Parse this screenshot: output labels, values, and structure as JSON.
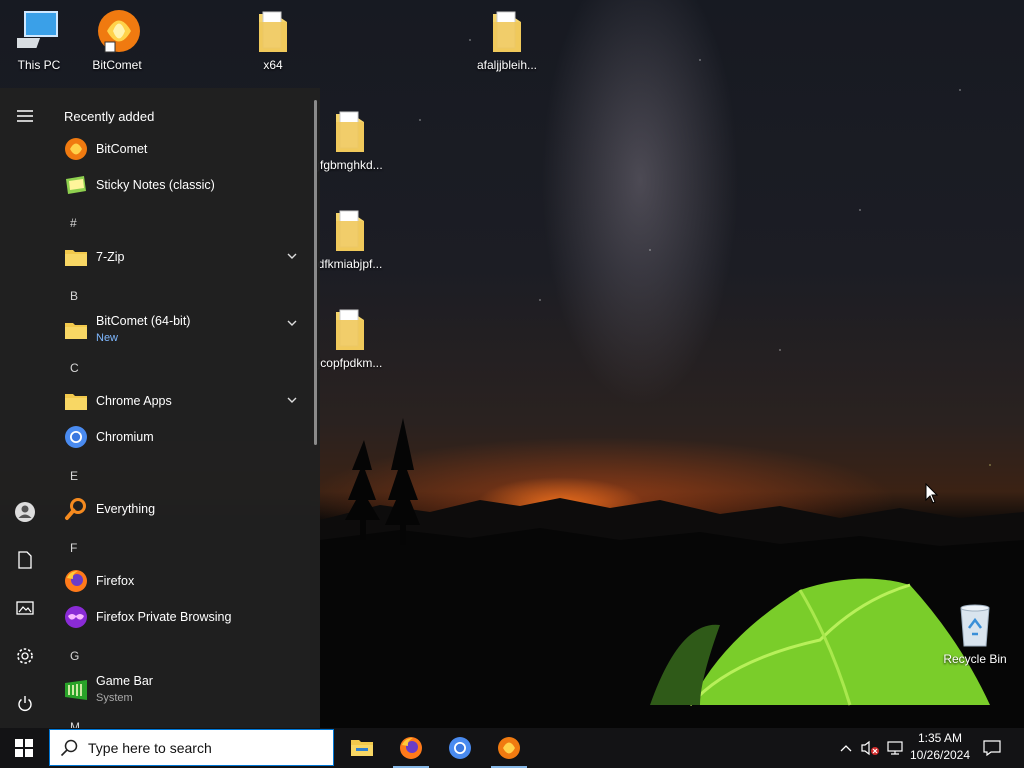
{
  "desktop": {
    "icons": [
      {
        "label": "This PC"
      },
      {
        "label": "BitComet"
      },
      {
        "label": "x64"
      },
      {
        "label": "afaljjbleih..."
      },
      {
        "label": "jfgbmghkd..."
      },
      {
        "label": "dfkmiabjpf..."
      },
      {
        "label": "jcopfpdkm..."
      },
      {
        "label": "Recycle Bin"
      }
    ]
  },
  "start_menu": {
    "section_title": "Recently added",
    "recent": [
      {
        "name": "BitComet",
        "icon": "bitcomet-icon"
      },
      {
        "name": "Sticky Notes (classic)",
        "icon": "sticky-notes-icon"
      }
    ],
    "letters": [
      "#",
      "B",
      "C",
      "E",
      "F",
      "G",
      "M"
    ],
    "apps": [
      {
        "name": "7-Zip",
        "icon": "folder-icon",
        "expandable": true
      },
      {
        "name": "BitComet (64-bit)",
        "sub": "New",
        "icon": "folder-icon",
        "expandable": true
      },
      {
        "name": "Chrome Apps",
        "icon": "folder-icon",
        "expandable": true
      },
      {
        "name": "Chromium",
        "icon": "chromium-icon"
      },
      {
        "name": "Everything",
        "icon": "everything-icon"
      },
      {
        "name": "Firefox",
        "icon": "firefox-icon"
      },
      {
        "name": "Firefox Private Browsing",
        "icon": "firefox-private-icon"
      },
      {
        "name": "Game Bar",
        "sub": "System",
        "icon": "game-bar-icon"
      }
    ],
    "rail": [
      "hamburger-icon",
      "user-icon",
      "documents-icon",
      "pictures-icon",
      "settings-icon",
      "power-icon"
    ]
  },
  "taskbar": {
    "search_placeholder": "Type here to search",
    "pinned": [
      "file-explorer-icon",
      "firefox-icon",
      "chromium-icon",
      "bitcomet-icon"
    ],
    "clock_time": "1:35 AM",
    "clock_date": "10/26/2024"
  },
  "colors": {
    "accent": "#0078d7",
    "start_bg": "#202020",
    "taskbar_bg": "#141416"
  }
}
